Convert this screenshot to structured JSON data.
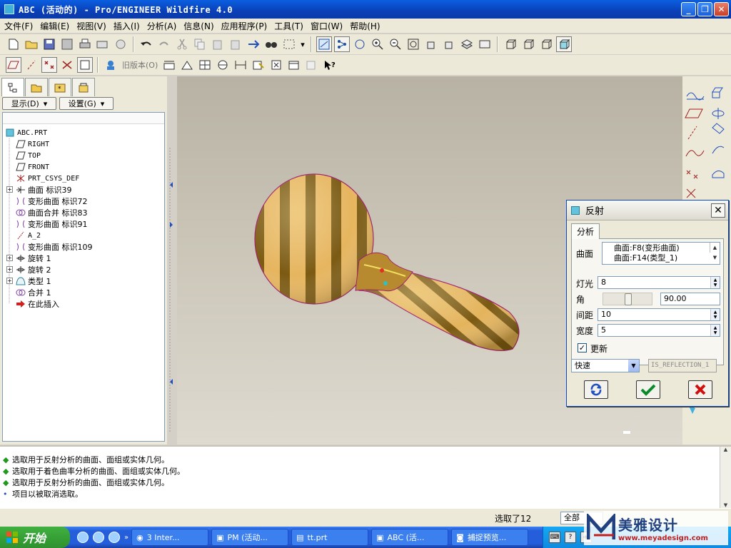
{
  "window": {
    "title": "ABC (活动的) - Pro/ENGINEER Wildfire 4.0"
  },
  "menu": [
    "文件(F)",
    "编辑(E)",
    "视图(V)",
    "插入(I)",
    "分析(A)",
    "信息(N)",
    "应用程序(P)",
    "工具(T)",
    "窗口(W)",
    "帮助(H)"
  ],
  "toolbar2": {
    "old_version_label": "旧版本(O)"
  },
  "navigator": {
    "show_button": "显示(D)",
    "settings_button": "设置(G)",
    "tree": [
      {
        "label": "ABC.PRT",
        "icon": "part-icon"
      },
      {
        "label": "RIGHT",
        "icon": "datum-plane-icon"
      },
      {
        "label": "TOP",
        "icon": "datum-plane-icon"
      },
      {
        "label": "FRONT",
        "icon": "datum-plane-icon"
      },
      {
        "label": "PRT_CSYS_DEF",
        "icon": "csys-icon"
      },
      {
        "label": "曲面 标识39",
        "icon": "surface-icon"
      },
      {
        "label": "变形曲面 标识72",
        "icon": "warp-surface-icon"
      },
      {
        "label": "曲面合并 标识83",
        "icon": "merge-icon"
      },
      {
        "label": "变形曲面 标识91",
        "icon": "warp-surface-icon"
      },
      {
        "label": "A_2",
        "icon": "axis-icon"
      },
      {
        "label": "变形曲面 标识109",
        "icon": "warp-surface-icon"
      },
      {
        "label": "旋转 1",
        "icon": "revolve-icon"
      },
      {
        "label": "旋转 2",
        "icon": "revolve-icon"
      },
      {
        "label": "类型 1",
        "icon": "style-icon"
      },
      {
        "label": "合并 1",
        "icon": "merge-icon"
      },
      {
        "label": "在此插入",
        "icon": "insert-arrow-icon"
      }
    ]
  },
  "dialog": {
    "title": "反射",
    "tab": "分析",
    "surface_label": "曲面",
    "surfaces": [
      "曲面:F8(变形曲面)",
      "曲面:F14(类型_1)"
    ],
    "light_label": "灯光",
    "light_value": "8",
    "angle_label": "角",
    "angle_value": "90.00",
    "spacing_label": "间距",
    "spacing_value": "10",
    "width_label": "宽度",
    "width_value": "5",
    "update_label": "更新",
    "update_checked": true,
    "mode_value": "快速",
    "name_value": "IS_REFLECTION_1"
  },
  "messages": [
    {
      "text": "选取用于反射分析的曲面、面组或实体几何。",
      "type": "prompt"
    },
    {
      "text": "选取用于着色曲率分析的曲面、面组或实体几何。",
      "type": "prompt"
    },
    {
      "text": "选取用于反射分析的曲面、面组或实体几何。",
      "type": "prompt"
    },
    {
      "text": "项目以被取消选取。",
      "type": "info"
    }
  ],
  "status": {
    "selected": "选取了12",
    "filter": "全部"
  },
  "taskbar": {
    "start": "开始",
    "tasks": [
      "3 Inter...",
      "PM (活动...",
      "tt.prt",
      "ABC (活...",
      "捕捉预览..."
    ]
  },
  "watermark": {
    "brand": "美雅设计",
    "url": "www.meyadesign.com"
  },
  "colors": {
    "stripe_dark": "#7a5a10",
    "stripe_light": "#e8b860",
    "title_blue": "#0a4fd0"
  }
}
